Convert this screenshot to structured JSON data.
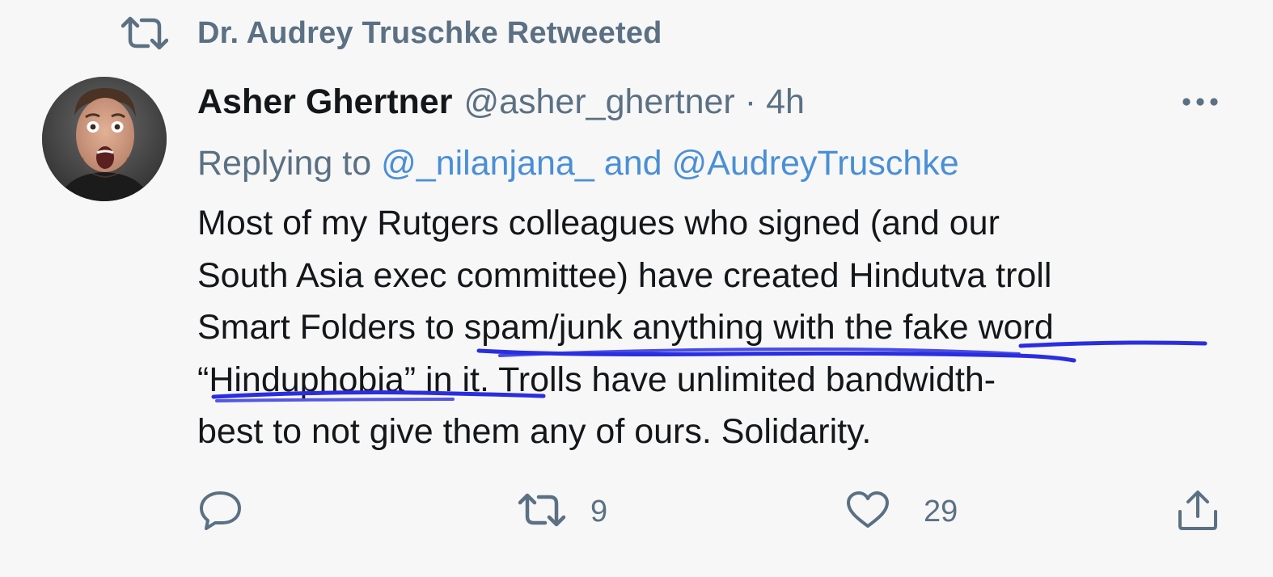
{
  "retweet_context": {
    "text": "Dr. Audrey Truschke Retweeted",
    "icon": "retweet-icon"
  },
  "tweet": {
    "author_name": "Asher Ghertner",
    "handle": "@asher_ghertner",
    "separator": "·",
    "timestamp": "4h",
    "more_icon": "more-horizontal-icon",
    "replying_prefix": "Replying to",
    "reply_mention_1": "@_nilanjana_",
    "reply_and": "and",
    "reply_mention_2": "@AudreyTruschke",
    "text_lines": [
      "Most of my Rutgers colleagues who signed (and our",
      "South Asia exec committee) have created Hindutva troll",
      "Smart Folders to spam/junk anything with the fake word",
      "“Hinduphobia” in it. Trolls have unlimited bandwidth-",
      "best to not give them any of ours. Solidarity."
    ]
  },
  "actions": {
    "reply_icon": "reply-icon",
    "retweet_icon": "retweet-icon",
    "retweet_count": "9",
    "like_icon": "heart-icon",
    "like_count": "29",
    "share_icon": "share-icon"
  },
  "colors": {
    "background": "#f7f7f7",
    "text_primary": "#14171a",
    "text_secondary": "#5b7083",
    "link": "#4a8fd6",
    "annotation_ink": "#2a2ee0"
  }
}
